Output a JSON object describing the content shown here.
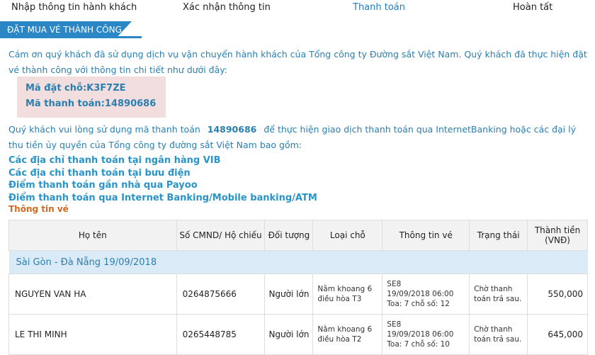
{
  "steps": [
    "Nhập thông tin hành khách",
    "Xác nhận thông tin",
    "Thanh toán",
    "Hoàn tất"
  ],
  "banner": "ĐẶT MUA VÉ THÀNH CÔNG",
  "intro_1": "Cám ơn quý khách đã sử dụng dịch vụ vận chuyển hành khách của Tổng công ty Đường sắt Việt Nam. Quý khách đã thực hiện đặt vé thành công với thông tin chi tiết như dưới đây:",
  "booking": {
    "code_label": "Mã đặt chỗ:",
    "code": "K3F7ZE",
    "pay_label": "Mã thanh toán:",
    "pay_code": "14890686"
  },
  "instruction": {
    "before": "Quý khách vui lòng sử dụng mã thanh toán",
    "code": "14890686",
    "after": "để thực hiện giao dịch thanh toán qua InternetBanking hoặc các đại lý thu tiền ủy quyền của Tổng công ty đường sắt Việt Nam bao gồm:"
  },
  "links": [
    "Các địa chỉ thanh toán tại ngân hàng VIB",
    "Các địa chỉ thanh toán tại bưu điện",
    "Điểm thanh toán gần nhà qua Payoo",
    "Điểm thanh toán qua Internet Banking/Mobile banking/ATM"
  ],
  "ticket_title": "Thông tin vé",
  "table": {
    "headers": [
      "Họ tên",
      "Số CMND/ Hộ chiếu",
      "Đối tượng",
      "Loại chỗ",
      "Thông tin vé",
      "Trạng thái",
      "Thành tiền (VNĐ)"
    ],
    "group": "Sài Gòn - Đà Nẵng 19/09/2018",
    "rows": [
      {
        "name": "NGUYEN VAN HA",
        "id": "0264875666",
        "type": "Người lớn",
        "seat": "Nằm khoang 6 điều hòa T3",
        "train": "SE8",
        "datetime": "19/09/2018 06:00",
        "car": "Toa: 7 chỗ số: 12",
        "status": "Chờ thanh toán trả sau.",
        "price": "550,000"
      },
      {
        "name": "LE THI MINH",
        "id": "0265448785",
        "type": "Người lớn",
        "seat": "Nằm khoang 6 điều hòa T2",
        "train": "SE8",
        "datetime": "19/09/2018 06:00",
        "car": "Toa: 7 chỗ số: 10",
        "status": "Chờ thanh toán trả sau.",
        "price": "645,000"
      }
    ]
  }
}
